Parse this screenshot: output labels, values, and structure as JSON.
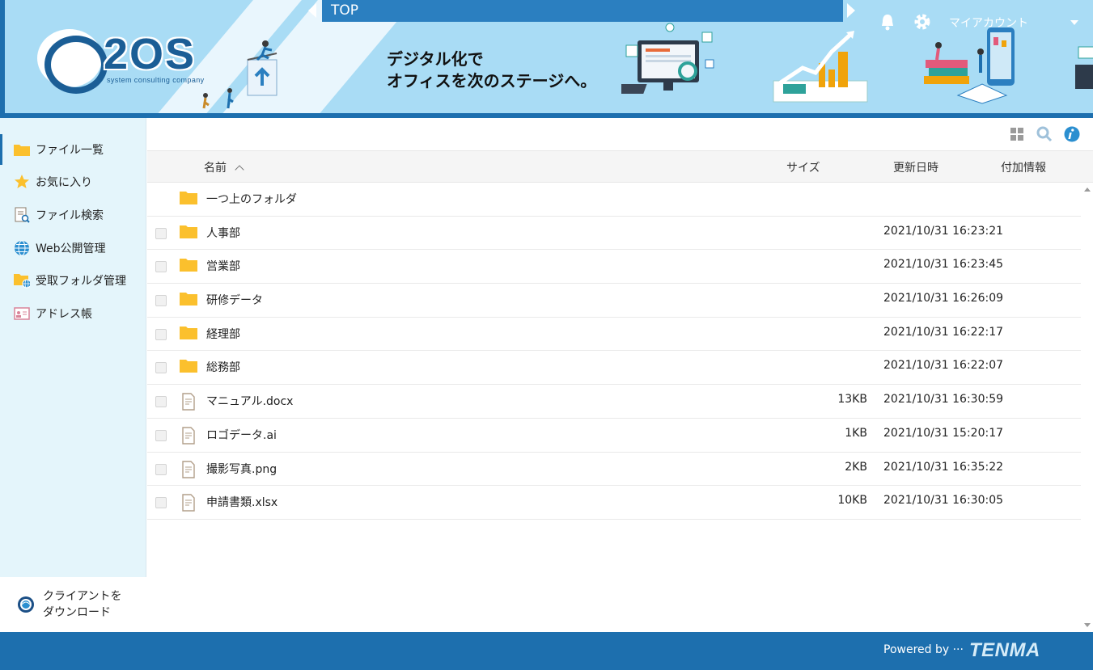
{
  "header": {
    "breadcrumb": "TOP",
    "logo_text": "2OS",
    "logo_sub": "system consulting company",
    "tagline_line1": "デジタル化で",
    "tagline_line2": "オフィスを次のステージへ。",
    "account_label": "マイアカウント",
    "colors": {
      "banner": "#a9dcf5",
      "accent": "#1d6fae",
      "topbar": "#2b7fc0"
    }
  },
  "sidebar": {
    "items": [
      {
        "label": "ファイル一覧",
        "icon": "folder-icon",
        "active": true
      },
      {
        "label": "お気に入り",
        "icon": "star-icon"
      },
      {
        "label": "ファイル検索",
        "icon": "file-search-icon"
      },
      {
        "label": "Web公開管理",
        "icon": "globe-icon"
      },
      {
        "label": "受取フォルダ管理",
        "icon": "folder-globe-icon"
      },
      {
        "label": "アドレス帳",
        "icon": "address-book-icon"
      }
    ],
    "download_line1": "クライアントを",
    "download_line2": "ダウンロード"
  },
  "list": {
    "columns": {
      "name": "名前",
      "size": "サイズ",
      "updated": "更新日時",
      "extra": "付加情報"
    },
    "parent_folder": "一つ上のフォルダ",
    "rows": [
      {
        "name": "人事部",
        "type": "folder",
        "size": "",
        "date": "2021/10/31 16:23:21"
      },
      {
        "name": "営業部",
        "type": "folder",
        "size": "",
        "date": "2021/10/31 16:23:45"
      },
      {
        "name": "研修データ",
        "type": "folder",
        "size": "",
        "date": "2021/10/31 16:26:09"
      },
      {
        "name": "経理部",
        "type": "folder",
        "size": "",
        "date": "2021/10/31 16:22:17"
      },
      {
        "name": "総務部",
        "type": "folder",
        "size": "",
        "date": "2021/10/31 16:22:07"
      },
      {
        "name": "マニュアル.docx",
        "type": "file",
        "size": "13KB",
        "date": "2021/10/31 16:30:59"
      },
      {
        "name": "ロゴデータ.ai",
        "type": "file",
        "size": "1KB",
        "date": "2021/10/31 15:20:17"
      },
      {
        "name": "撮影写真.png",
        "type": "file",
        "size": "2KB",
        "date": "2021/10/31 16:35:22"
      },
      {
        "name": "申請書類.xlsx",
        "type": "file",
        "size": "10KB",
        "date": "2021/10/31 16:30:05"
      }
    ]
  },
  "footer": {
    "powered_by": "Powered by ···",
    "brand": "TENMA"
  }
}
